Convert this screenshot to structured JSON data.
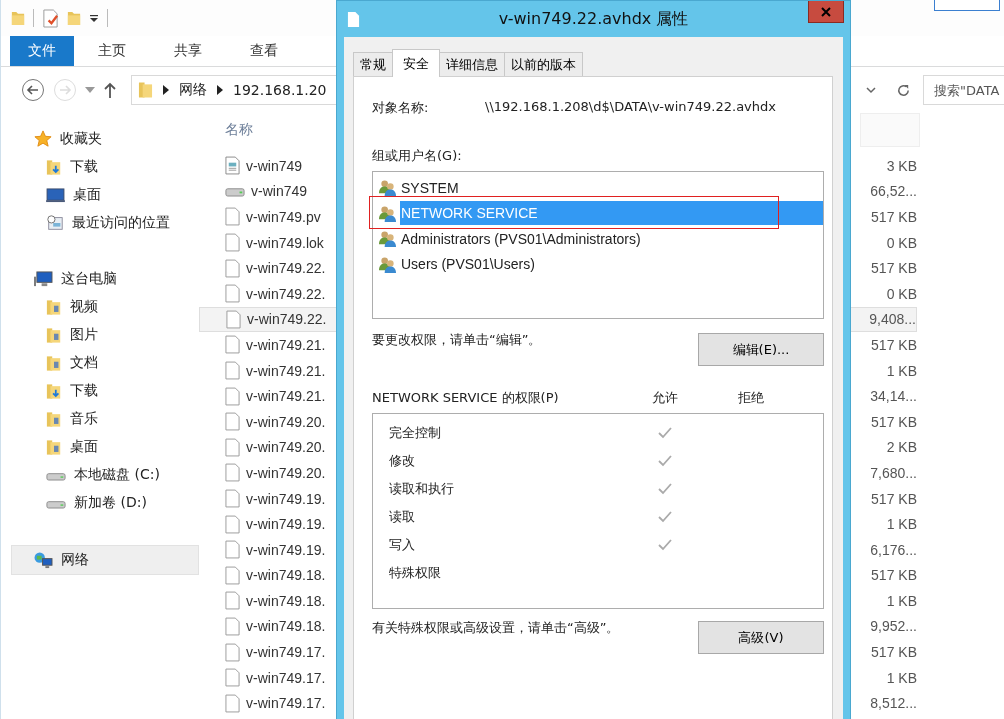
{
  "explorer": {
    "ribbon_tabs": [
      {
        "label": "文件",
        "selected": true
      },
      {
        "label": "主页",
        "selected": false
      },
      {
        "label": "共享",
        "selected": false
      },
      {
        "label": "查看",
        "selected": false
      }
    ],
    "address": {
      "breadcrumbs": [
        "网络",
        "192.168.1.20"
      ],
      "forward_disabled": true
    },
    "search": {
      "placeholder": "搜索\"DATA"
    },
    "nav": [
      {
        "label": "收藏夹",
        "selected": false,
        "children": [
          {
            "label": "下载",
            "selected": false
          },
          {
            "label": "桌面",
            "selected": false
          },
          {
            "label": "最近访问的位置",
            "selected": false
          }
        ]
      },
      {
        "label": "这台电脑",
        "selected": false,
        "children": [
          {
            "label": "视频",
            "selected": false
          },
          {
            "label": "图片",
            "selected": false
          },
          {
            "label": "文档",
            "selected": false
          },
          {
            "label": "下载",
            "selected": false
          },
          {
            "label": "音乐",
            "selected": false
          },
          {
            "label": "桌面",
            "selected": false
          },
          {
            "label": "本地磁盘 (C:)",
            "selected": false
          },
          {
            "label": "新加卷 (D:)",
            "selected": false
          }
        ]
      },
      {
        "label": "网络",
        "selected": true
      }
    ],
    "list_header": "名称",
    "files": [
      {
        "name": "v-win749",
        "size": "3 KB",
        "selected": false
      },
      {
        "name": "v-win749",
        "size": "66,52...",
        "selected": false
      },
      {
        "name": "v-win749.pv",
        "size": "517 KB",
        "selected": false
      },
      {
        "name": "v-win749.lok",
        "size": "0 KB",
        "selected": false
      },
      {
        "name": "v-win749.22.",
        "size": "517 KB",
        "selected": false
      },
      {
        "name": "v-win749.22.",
        "size": "0 KB",
        "selected": false
      },
      {
        "name": "v-win749.22.",
        "size": "9,408...",
        "selected": true
      },
      {
        "name": "v-win749.21.",
        "size": "517 KB",
        "selected": false
      },
      {
        "name": "v-win749.21.",
        "size": "1 KB",
        "selected": false
      },
      {
        "name": "v-win749.21.",
        "size": "34,14...",
        "selected": false
      },
      {
        "name": "v-win749.20.",
        "size": "517 KB",
        "selected": false
      },
      {
        "name": "v-win749.20.",
        "size": "2 KB",
        "selected": false
      },
      {
        "name": "v-win749.20.",
        "size": "7,680...",
        "selected": false
      },
      {
        "name": "v-win749.19.",
        "size": "517 KB",
        "selected": false
      },
      {
        "name": "v-win749.19.",
        "size": "1 KB",
        "selected": false
      },
      {
        "name": "v-win749.19.",
        "size": "6,176...",
        "selected": false
      },
      {
        "name": "v-win749.18.",
        "size": "517 KB",
        "selected": false
      },
      {
        "name": "v-win749.18.",
        "size": "1 KB",
        "selected": false
      },
      {
        "name": "v-win749.18.",
        "size": "9,952...",
        "selected": false
      },
      {
        "name": "v-win749.17.",
        "size": "517 KB",
        "selected": false
      },
      {
        "name": "v-win749.17.",
        "size": "1 KB",
        "selected": false
      },
      {
        "name": "v-win749.17.",
        "size": "8,512...",
        "selected": false
      }
    ]
  },
  "dialog": {
    "title": "v-win749.22.avhdx 属性",
    "tabs": [
      {
        "label": "常规",
        "selected": false
      },
      {
        "label": "安全",
        "selected": true
      },
      {
        "label": "详细信息",
        "selected": false
      },
      {
        "label": "以前的版本",
        "selected": false
      }
    ],
    "object_label": "对象名称:",
    "object_path": "\\\\192.168.1.208\\d$\\DATA\\v-win749.22.avhdx",
    "groups_label": "组或用户名(G):",
    "groups": [
      {
        "name": "SYSTEM",
        "selected": false,
        "highlighted": false
      },
      {
        "name": "NETWORK SERVICE",
        "selected": true,
        "highlighted": true
      },
      {
        "name": "Administrators (PVS01\\Administrators)",
        "selected": false,
        "highlighted": false
      },
      {
        "name": "Users (PVS01\\Users)",
        "selected": false,
        "highlighted": false
      }
    ],
    "edit_hint": "要更改权限，请单击“编辑”。",
    "edit_button": "编辑(E)...",
    "perm_title": "NETWORK SERVICE 的权限(P)",
    "allow_header": "允许",
    "deny_header": "拒绝",
    "permissions": [
      {
        "name": "完全控制",
        "allow": true,
        "deny": false
      },
      {
        "name": "修改",
        "allow": true,
        "deny": false
      },
      {
        "name": "读取和执行",
        "allow": true,
        "deny": false
      },
      {
        "name": "读取",
        "allow": true,
        "deny": false
      },
      {
        "name": "写入",
        "allow": true,
        "deny": false
      },
      {
        "name": "特殊权限",
        "allow": false,
        "deny": false
      }
    ],
    "advanced_hint": "有关特殊权限或高级设置，请单击“高级”。",
    "advanced_button": "高级(V)"
  }
}
